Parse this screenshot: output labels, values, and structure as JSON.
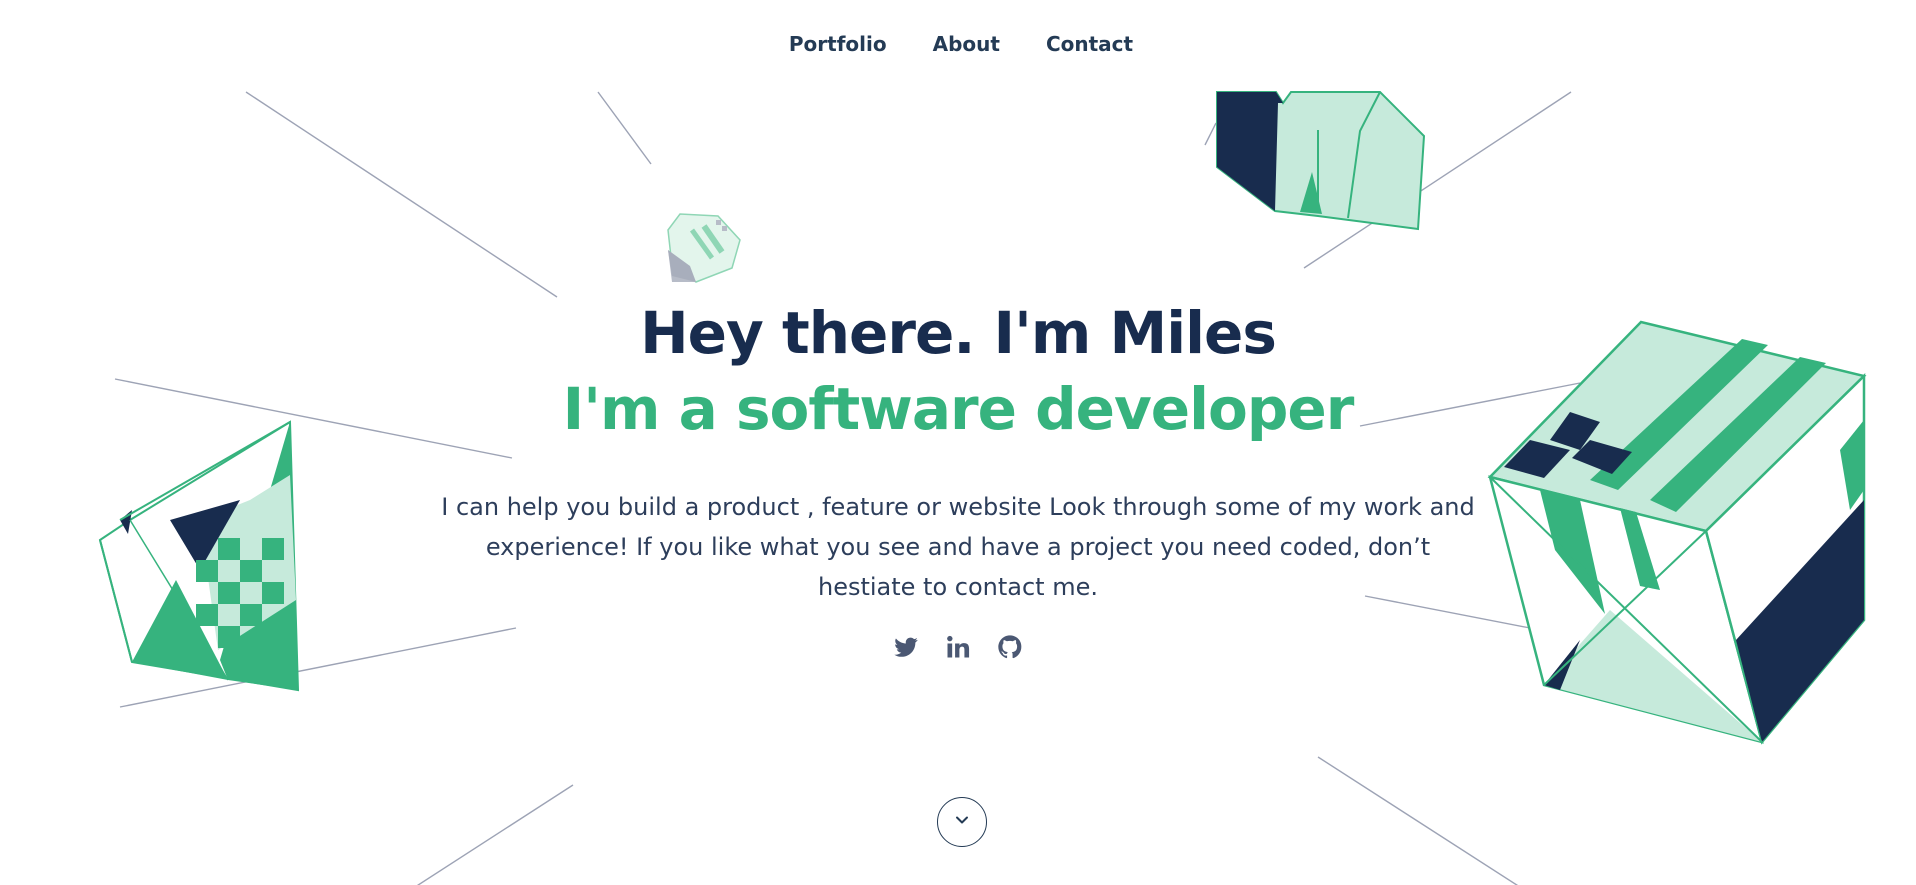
{
  "nav": {
    "items": [
      {
        "label": "Portfolio"
      },
      {
        "label": "About"
      },
      {
        "label": "Contact"
      }
    ]
  },
  "hero": {
    "title": "Hey there. I'm Miles",
    "subtitle": "I'm a software developer",
    "description": "I can help you build a product , feature or website Look through some of my work and experience! If you like what you see and have a project you need coded, don’t hestiate to contact me."
  },
  "social": {
    "icons": [
      "twitter-icon",
      "linkedin-icon",
      "github-icon"
    ]
  },
  "scroll": {
    "icon": "chevron-down-icon"
  },
  "colors": {
    "navy": "#182c4e",
    "green": "#36b37e",
    "mint": "#c6eadb",
    "text": "#2d3e5b",
    "line": "#9da3b5"
  }
}
